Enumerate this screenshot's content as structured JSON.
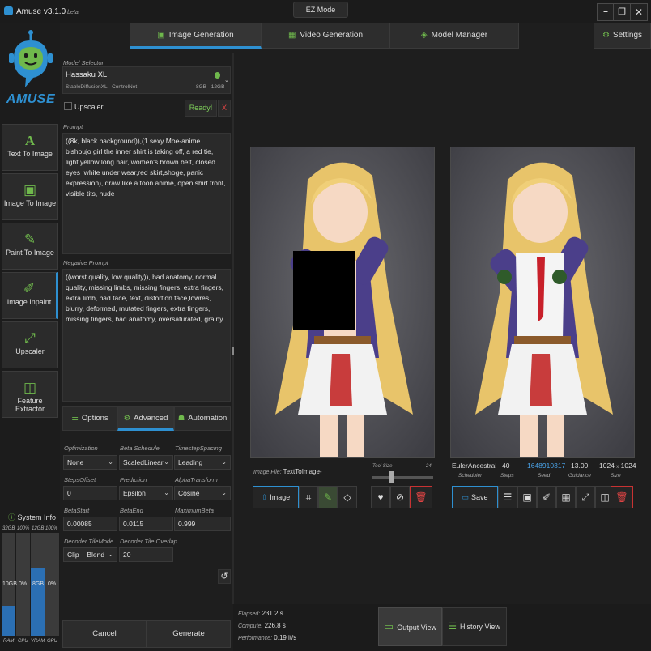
{
  "window": {
    "title": "Amuse v3.1.0",
    "beta": "beta",
    "ez_mode": "EZ Mode",
    "minimize": "⎯",
    "maximize": "❐",
    "close": "✕"
  },
  "tabs": [
    {
      "label": "Image Generation"
    },
    {
      "label": "Video Generation"
    },
    {
      "label": "Model Manager"
    }
  ],
  "settings_label": "Settings",
  "logo_text": "AMUSE",
  "nav": [
    {
      "label": "Text To Image",
      "icon": "A"
    },
    {
      "label": "Image To Image",
      "icon": "▣"
    },
    {
      "label": "Paint To Image",
      "icon": "✎"
    },
    {
      "label": "Image Inpaint",
      "icon": "✐"
    },
    {
      "label": "Upscaler",
      "icon": "⤢"
    },
    {
      "label": "Feature Extractor",
      "icon": "◫"
    }
  ],
  "system_info": {
    "title": "System Info",
    "bars": [
      {
        "top": "32GB",
        "pct": "100%",
        "value": "10GB",
        "name": "RAM",
        "fill": 0.3
      },
      {
        "top": "",
        "pct": "",
        "value": "0%",
        "name": "CPU",
        "fill": 0.0
      },
      {
        "top": "12GB",
        "pct": "100%",
        "value": "8GB",
        "name": "VRAM",
        "fill": 0.66
      },
      {
        "top": "",
        "pct": "",
        "value": "0%",
        "name": "GPU",
        "fill": 0.0
      }
    ]
  },
  "model": {
    "section_label": "Model Selector",
    "name": "Hassaku XL",
    "type": "StableDiffusionXL - ControlNet",
    "memory": "8GB - 12GB",
    "upscaler_label": "Upscaler",
    "ready": "Ready!",
    "remove": "X"
  },
  "prompt": {
    "label": "Prompt",
    "text": "((8k, black background)),(1 sexy Moe-anime bishoujo girl the inner shirt is taking off, a red tie, light yellow long hair, women's brown belt, closed eyes ,white under wear,red skirt,shoge, panic expression), draw like a toon anime, open shirt front, visible tits, nude"
  },
  "negative_prompt": {
    "label": "Negative Prompt",
    "text": "((worst quality, low quality)), bad anatomy, normal quality, missing limbs, missing fingers, extra fingers, extra limb, bad face, text, distortion face,lowres, blurry, deformed, mutated fingers, extra fingers, missing fingers, bad anatomy,  oversaturated, grainy"
  },
  "subtabs": [
    {
      "label": "Options"
    },
    {
      "label": "Advanced"
    },
    {
      "label": "Automation"
    }
  ],
  "advanced": {
    "optimization": {
      "label": "Optimization",
      "value": "None"
    },
    "beta_schedule": {
      "label": "Beta Schedule",
      "value": "ScaledLinear"
    },
    "timestep_spacing": {
      "label": "TimestepSpacing",
      "value": "Leading"
    },
    "steps_offset": {
      "label": "StepsOffset",
      "value": "0"
    },
    "prediction": {
      "label": "Prediction",
      "value": "Epsilon"
    },
    "alpha_transform": {
      "label": "AlphaTransform",
      "value": "Cosine"
    },
    "beta_start": {
      "label": "BetaStart",
      "value": "0.00085"
    },
    "beta_end": {
      "label": "BetaEnd",
      "value": "0.0115"
    },
    "maximum_beta": {
      "label": "MaximumBeta",
      "value": "0.999"
    },
    "decoder_tile_mode": {
      "label": "Decoder TileMode",
      "value": "Clip + Blend"
    },
    "decoder_tile_overlap": {
      "label": "Decoder Tile Overlap",
      "value": "20"
    }
  },
  "actions": {
    "cancel": "Cancel",
    "generate": "Generate"
  },
  "input_panel": {
    "image_file_label": "Image File:",
    "image_file_value": "TextToImage-",
    "tool_size_label": "Tool Size",
    "tool_size_max": "24",
    "tool_size_value": 0.3,
    "image_button": "Image"
  },
  "output": {
    "scheduler": {
      "value": "EulerAncestral",
      "label": "Scheduler"
    },
    "steps": {
      "value": "40",
      "label": "Steps"
    },
    "seed": {
      "value": "1648910317",
      "label": "Seed"
    },
    "guidance": {
      "value": "13.00",
      "label": "Guidance"
    },
    "size": {
      "width": "1024",
      "sep": "x",
      "height": "1024",
      "label": "Size"
    },
    "save": "Save"
  },
  "status": {
    "elapsed_label": "Elapsed:",
    "elapsed": "231.2 s",
    "compute_label": "Compute:",
    "compute": "226.8 s",
    "performance_label": "Performance:",
    "performance": "0.19 it/s"
  },
  "views": {
    "output": "Output View",
    "history": "History View"
  },
  "colors": {
    "accent_blue": "#2e90d1",
    "accent_green": "#6fb84c",
    "seed_blue": "#4aa3e8",
    "danger_red": "#c83232",
    "ready_green": "#7fd05a"
  }
}
